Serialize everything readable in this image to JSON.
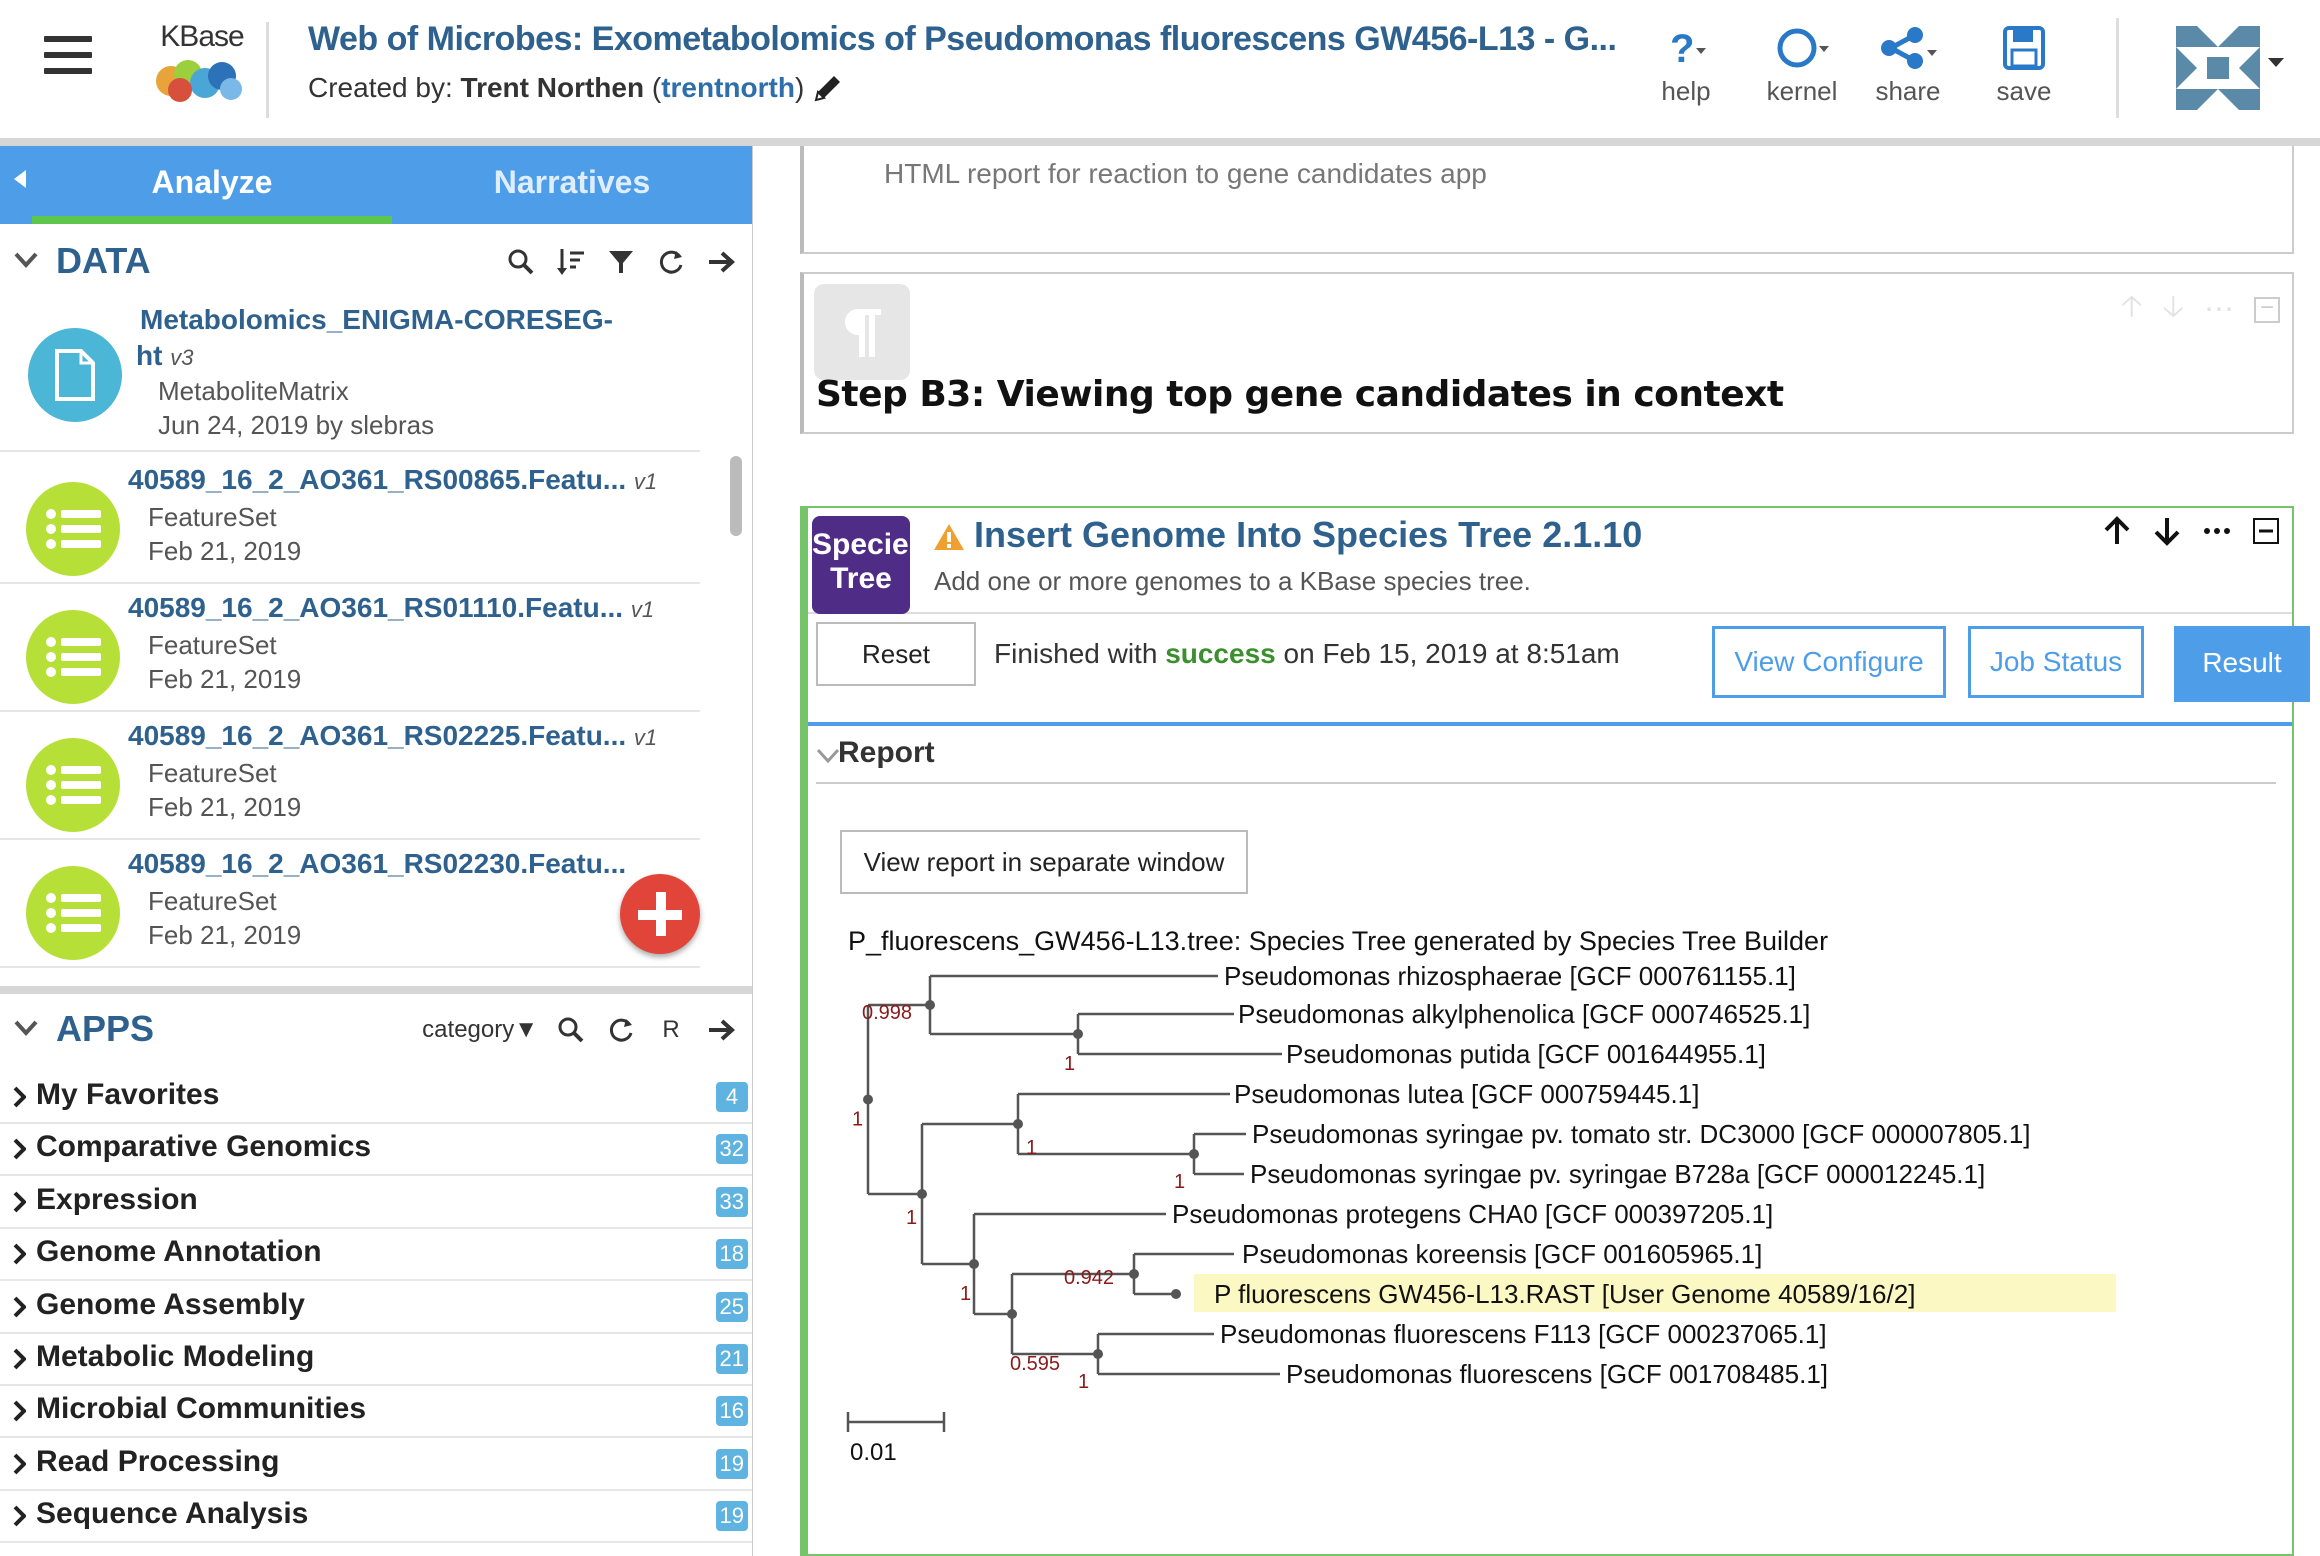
{
  "header": {
    "logo_text": "KBase",
    "narrative_title": "Web of Microbes: Exometabolomics of Pseudomonas fluorescens GW456-L13 - G...",
    "created_prefix": "Created by: ",
    "creator_name": "Trent Northen",
    "creator_username": "trentnorth",
    "buttons": {
      "help": "help",
      "kernel": "kernel",
      "share": "share",
      "save": "save"
    }
  },
  "side_panel": {
    "tabs": {
      "analyze": "Analyze",
      "narratives": "Narratives"
    },
    "data": {
      "title": "DATA",
      "items": [
        {
          "name_line1": "Metabolomics_ENIGMA-CORESEG-",
          "name_line2": "ht",
          "version": "v3",
          "type": "MetaboliteMatrix",
          "date": "Jun 24, 2019  by slebras",
          "icon": "document-icon",
          "color": "#4bb6d6"
        },
        {
          "name_line1": "40589_16_2_AO361_RS00865.Featu...",
          "version": "v1",
          "type": "FeatureSet",
          "date": "Feb 21, 2019",
          "icon": "list-icon",
          "color": "#b6e037"
        },
        {
          "name_line1": "40589_16_2_AO361_RS01110.Featu...",
          "version": "v1",
          "type": "FeatureSet",
          "date": "Feb 21, 2019",
          "icon": "list-icon",
          "color": "#b6e037"
        },
        {
          "name_line1": "40589_16_2_AO361_RS02225.Featu...",
          "version": "v1",
          "type": "FeatureSet",
          "date": "Feb 21, 2019",
          "icon": "list-icon",
          "color": "#b6e037"
        },
        {
          "name_line1": "40589_16_2_AO361_RS02230.Featu...",
          "version": "",
          "type": "FeatureSet",
          "date": "Feb 21, 2019",
          "icon": "list-icon",
          "color": "#b6e037"
        }
      ]
    },
    "apps": {
      "title": "APPS",
      "filter_label": "category",
      "r_label": "R",
      "categories": [
        {
          "name": "My Favorites",
          "count": "4"
        },
        {
          "name": "Comparative Genomics",
          "count": "32"
        },
        {
          "name": "Expression",
          "count": "33"
        },
        {
          "name": "Genome Annotation",
          "count": "18"
        },
        {
          "name": "Genome Assembly",
          "count": "25"
        },
        {
          "name": "Metabolic Modeling",
          "count": "21"
        },
        {
          "name": "Microbial Communities",
          "count": "16"
        },
        {
          "name": "Read Processing",
          "count": "19"
        },
        {
          "name": "Sequence Analysis",
          "count": "19"
        }
      ]
    }
  },
  "main": {
    "top_cell_desc": "HTML report for reaction to gene candidates app",
    "markdown_heading": "Step B3: Viewing top gene candidates in context",
    "app_cell": {
      "icon_line1": "Species",
      "icon_line2": "Tree",
      "title": "Insert Genome Into Species Tree 2.1.10",
      "subtitle": "Add one or more genomes to a KBase species tree.",
      "reset_label": "Reset",
      "status_prefix": "Finished with ",
      "status_word": "success",
      "status_suffix": " on Feb 15, 2019 at 8:51am",
      "view_configure": "View Configure",
      "job_status": "Job Status",
      "result": "Result",
      "report_title": "Report",
      "view_report_btn": "View report in separate window"
    },
    "tree": {
      "title": "P_fluorescens_GW456-L13.tree: Species Tree generated by Species Tree Builder",
      "leaves": [
        "Pseudomonas rhizosphaerae [GCF 000761155.1]",
        "Pseudomonas alkylphenolica [GCF 000746525.1]",
        "Pseudomonas putida [GCF 001644955.1]",
        "Pseudomonas lutea [GCF 000759445.1]",
        "Pseudomonas syringae pv. tomato str. DC3000 [GCF 000007805.1]",
        "Pseudomonas syringae pv. syringae B728a [GCF 000012245.1]",
        "Pseudomonas protegens CHA0 [GCF 000397205.1]",
        "Pseudomonas koreensis [GCF 001605965.1]",
        "P fluorescens GW456-L13.RAST [User Genome 40589/16/2]",
        "Pseudomonas fluorescens F113 [GCF 000237065.1]",
        "Pseudomonas fluorescens [GCF 001708485.1]"
      ],
      "support_values": [
        "0.998",
        "1",
        "1",
        "1",
        "1",
        "1",
        "1",
        "0.942",
        "0.595",
        "1"
      ],
      "scale_label": "0.01",
      "highlight_color": "#fbf8c4",
      "support_color": "#8b1a1a"
    }
  },
  "colors": {
    "title_blue": "#2e618d",
    "tab_bar": "#4d9de8",
    "success": "#3b8f2e",
    "add_button": "#e1453a"
  }
}
